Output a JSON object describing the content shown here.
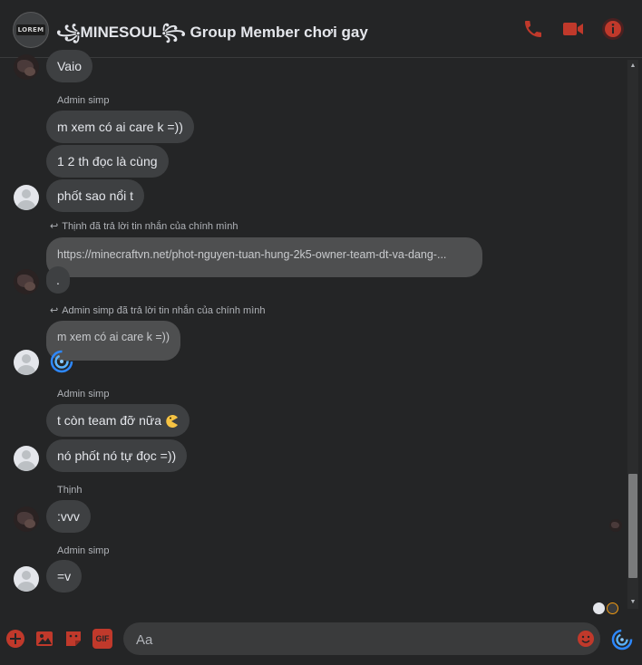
{
  "header": {
    "title": "꧁MINESOUL꧂ Group Member chơi gay",
    "logo_text": "LOREM",
    "icons": [
      "phone-icon",
      "video-camera-icon",
      "info-icon"
    ],
    "accent": "#c0392b"
  },
  "messages": {
    "m1": {
      "text": "Vaio"
    },
    "g2": {
      "sender": "Admin simp",
      "lines": [
        "m xem có ai care k =))",
        "1 2 th đọc là cùng",
        "phốt sao nổi t"
      ]
    },
    "g3": {
      "reply_note": "Thịnh đã trả lời tin nhắn của chính mình",
      "quoted": "https://minecraftvn.net/phot-nguyen-tuan-hung-2k5-owner-team-dt-va-dang-...",
      "text": "."
    },
    "g4": {
      "reply_note": "Admin simp đã trả lời tin nhắn của chính mình",
      "quoted": "m xem có ai care k =))"
    },
    "g5": {
      "sender": "Admin simp",
      "lines": [
        "t còn team đỡ nữa",
        "nó phốt nó tự đọc =))"
      ]
    },
    "g6": {
      "sender": "Thịnh",
      "text": ":vvv"
    },
    "g7": {
      "sender": "Admin simp",
      "text": "=v"
    }
  },
  "composer": {
    "placeholder": "Aa"
  },
  "bottom_icons": [
    "add-circle-icon",
    "image-icon",
    "sticker-icon",
    "gif-icon",
    "emoji-icon",
    "messenger-swirl-icon"
  ],
  "bottom_gif_label": "GIF"
}
